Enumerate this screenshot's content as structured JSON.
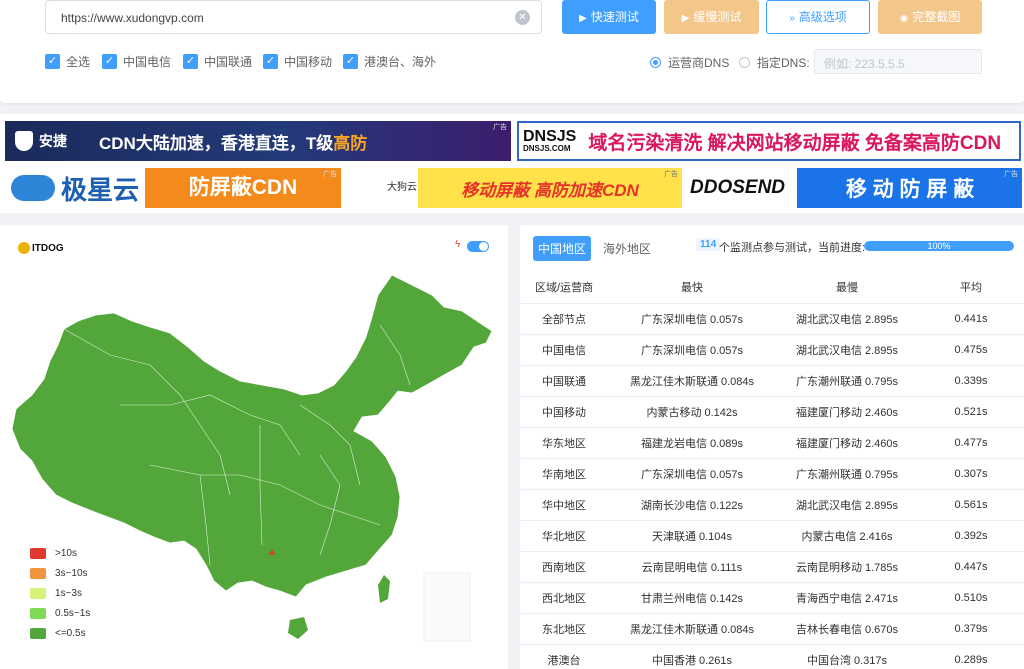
{
  "search": {
    "url": "https://www.xudongvp.com"
  },
  "buttons": {
    "fast": "快速测试",
    "slow": "缓慢测试",
    "advanced": "高级选项",
    "screenshot": "完整截图"
  },
  "checkboxes": [
    "全选",
    "中国电信",
    "中国联通",
    "中国移动",
    "港澳台、海外"
  ],
  "dns": {
    "isp_label": "运营商DNS",
    "custom_label": "指定DNS:",
    "placeholder": "例如: 223.5.5.5"
  },
  "ads": {
    "a1": {
      "brand": "安捷",
      "text": "CDN大陆加速，香港直连，T级",
      "hl": "高防",
      "tag": "广告"
    },
    "a2": {
      "brand": "DNSJS",
      "sub": "DNSJS.COM",
      "text": "域名污染清洗 解决网站移动屏蔽 免备案高防CDN"
    },
    "a3": {
      "brand": "极星云",
      "text": "防屏蔽CDN",
      "tag": "广告"
    },
    "a4": {
      "brand": "大狗云",
      "text": "移动屏蔽 高防加速CDN",
      "tag": "广告"
    },
    "a5": {
      "brand": "DDOSEND",
      "text": "移 动 防 屏 蔽",
      "tag": "广告"
    }
  },
  "map": {
    "logo": "ITDOG",
    "legend": [
      {
        "label": ">10s",
        "color": "#e03a2f"
      },
      {
        "label": "3s~10s",
        "color": "#f0943e"
      },
      {
        "label": "1s~3s",
        "color": "#d5f27a"
      },
      {
        "label": "0.5s~1s",
        "color": "#7ed957"
      },
      {
        "label": "<=0.5s",
        "color": "#52a63a"
      }
    ]
  },
  "results": {
    "tabs": [
      "中国地区",
      "海外地区"
    ],
    "count": "114",
    "progress_label": "个监测点参与测试，当前进度:",
    "progress_text": "100%",
    "progress_value": 1.0,
    "columns": [
      "区域/运营商",
      "最快",
      "最慢",
      "平均"
    ],
    "rows": [
      [
        "全部节点",
        "广东深圳电信 0.057s",
        "湖北武汉电信 2.895s",
        "0.441s"
      ],
      [
        "中国电信",
        "广东深圳电信 0.057s",
        "湖北武汉电信 2.895s",
        "0.475s"
      ],
      [
        "中国联通",
        "黑龙江佳木斯联通 0.084s",
        "广东潮州联通 0.795s",
        "0.339s"
      ],
      [
        "中国移动",
        "内蒙古移动 0.142s",
        "福建厦门移动 2.460s",
        "0.521s"
      ],
      [
        "华东地区",
        "福建龙岩电信 0.089s",
        "福建厦门移动 2.460s",
        "0.477s"
      ],
      [
        "华南地区",
        "广东深圳电信 0.057s",
        "广东潮州联通 0.795s",
        "0.307s"
      ],
      [
        "华中地区",
        "湖南长沙电信 0.122s",
        "湖北武汉电信 2.895s",
        "0.561s"
      ],
      [
        "华北地区",
        "天津联通 0.104s",
        "内蒙古电信 2.416s",
        "0.392s"
      ],
      [
        "西南地区",
        "云南昆明电信 0.111s",
        "云南昆明移动 1.785s",
        "0.447s"
      ],
      [
        "西北地区",
        "甘肃兰州电信 0.142s",
        "青海西宁电信 2.471s",
        "0.510s"
      ],
      [
        "东北地区",
        "黑龙江佳木斯联通 0.084s",
        "吉林长春电信 0.670s",
        "0.379s"
      ],
      [
        "港澳台",
        "中国香港 0.261s",
        "中国台湾 0.317s",
        "0.289s"
      ]
    ]
  }
}
